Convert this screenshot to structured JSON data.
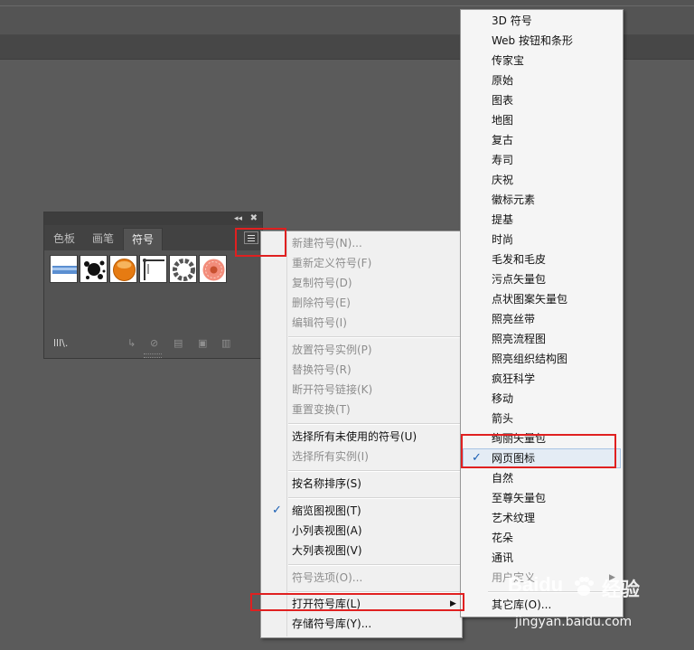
{
  "panel": {
    "tabs": [
      "色板",
      "画笔",
      "符号"
    ],
    "active_tab": "符号",
    "symbols": [
      "blue-banner",
      "ink-splatter",
      "orange-button",
      "corner-frame",
      "ring-wreath",
      "pink-flower"
    ]
  },
  "context_menu": {
    "items": [
      {
        "label": "新建符号(N)...",
        "enabled": false
      },
      {
        "label": "重新定义符号(F)",
        "enabled": false
      },
      {
        "label": "复制符号(D)",
        "enabled": false
      },
      {
        "label": "删除符号(E)",
        "enabled": false
      },
      {
        "label": "编辑符号(I)",
        "enabled": false
      },
      {
        "label": "放置符号实例(P)",
        "enabled": false
      },
      {
        "label": "替换符号(R)",
        "enabled": false
      },
      {
        "label": "断开符号链接(K)",
        "enabled": false
      },
      {
        "label": "重置变换(T)",
        "enabled": false
      },
      {
        "label": "选择所有未使用的符号(U)",
        "enabled": true
      },
      {
        "label": "选择所有实例(I)",
        "enabled": false
      },
      {
        "label": "按名称排序(S)",
        "enabled": true
      },
      {
        "label": "缩览图视图(T)",
        "enabled": true,
        "checked": true
      },
      {
        "label": "小列表视图(A)",
        "enabled": true
      },
      {
        "label": "大列表视图(V)",
        "enabled": true
      },
      {
        "label": "符号选项(O)...",
        "enabled": false
      },
      {
        "label": "打开符号库(L)",
        "enabled": true,
        "submenu": true
      },
      {
        "label": "存储符号库(Y)...",
        "enabled": true
      }
    ]
  },
  "submenu": {
    "items": [
      "3D 符号",
      "Web 按钮和条形",
      "传家宝",
      "原始",
      "图表",
      "地图",
      "复古",
      "寿司",
      "庆祝",
      "徽标元素",
      "提基",
      "时尚",
      "毛发和毛皮",
      "污点矢量包",
      "点状图案矢量包",
      "照亮丝带",
      "照亮流程图",
      "照亮组织结构图",
      "疯狂科学",
      "移动",
      "箭头",
      "绚丽矢量包",
      "网页图标",
      "自然",
      "至尊矢量包",
      "艺术纹理",
      "花朵",
      "通讯"
    ],
    "checked_item": "网页图标",
    "user_defined": "用户定义",
    "other_library": "其它库(O)..."
  },
  "watermark": {
    "logo": "Baidu",
    "suffix": "经验",
    "url": "jingyan.baidu.com"
  },
  "colors": {
    "highlight_box": "#e02020",
    "check": "#1a5fb4"
  }
}
